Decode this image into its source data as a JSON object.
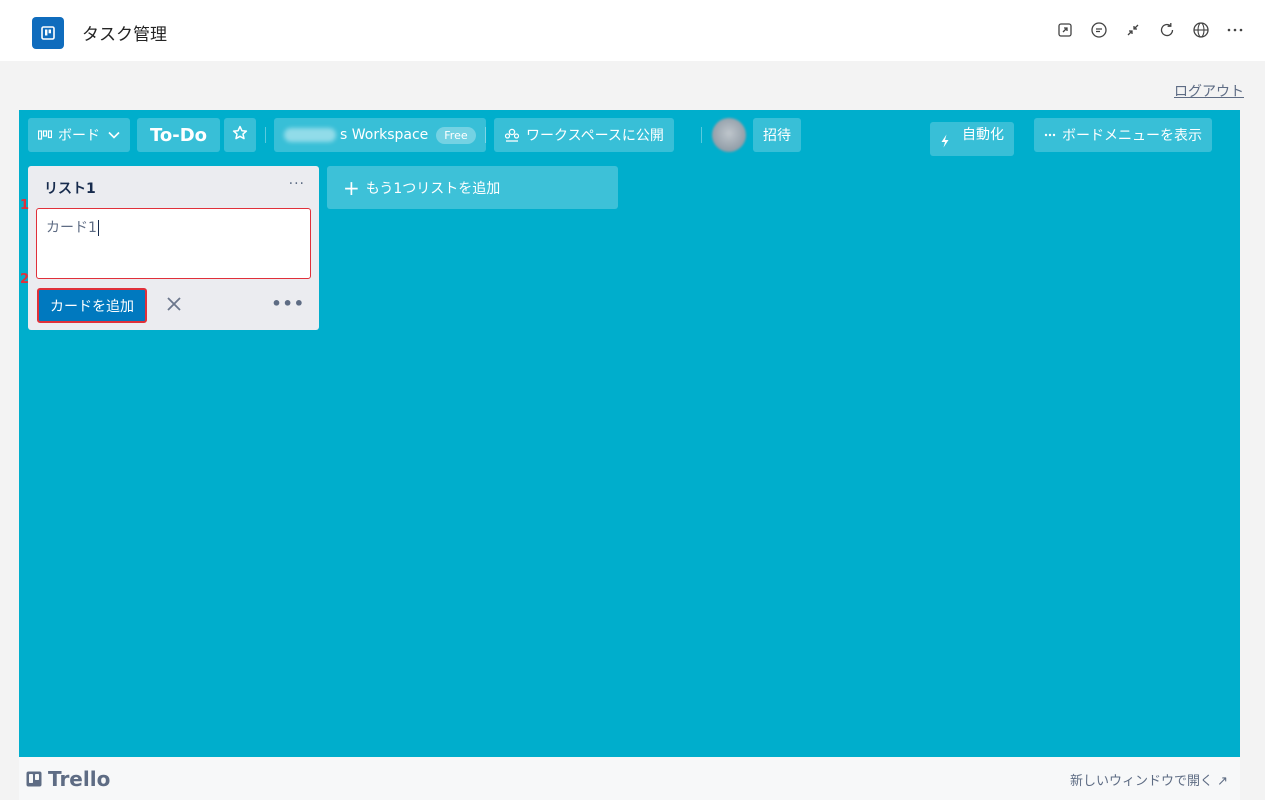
{
  "app": {
    "title": "タスク管理",
    "icon": "trello-board-icon"
  },
  "host_actions": [
    "open-external-icon",
    "chat-icon",
    "collapse-icon",
    "refresh-icon",
    "globe-icon",
    "more-icon"
  ],
  "logout_label": "ログアウト",
  "board": {
    "background_color": "#00aecc",
    "view_switcher_label": "ボード",
    "title": "To-Do",
    "workspace_name_suffix": "s Workspace",
    "workspace_badge": "Free",
    "visibility_label": "ワークスペースに公開",
    "invite_label": "招待",
    "automation_label": "自動化",
    "menu_label": "ボードメニューを表示"
  },
  "list": {
    "title": "リスト1",
    "menu_label": "···",
    "composer_value": "カード1",
    "add_card_label": "カードを追加",
    "composer_more_label": "•••"
  },
  "add_list_label": "もう1つリストを追加",
  "markers": {
    "first": "1",
    "second": "2"
  },
  "footer": {
    "brand": "Trello",
    "new_window_label": "新しいウィンドウで開く ↗"
  },
  "colors": {
    "accent": "#0079bf",
    "highlight": "#e0303a",
    "host_brand": "#0f6cbd"
  }
}
